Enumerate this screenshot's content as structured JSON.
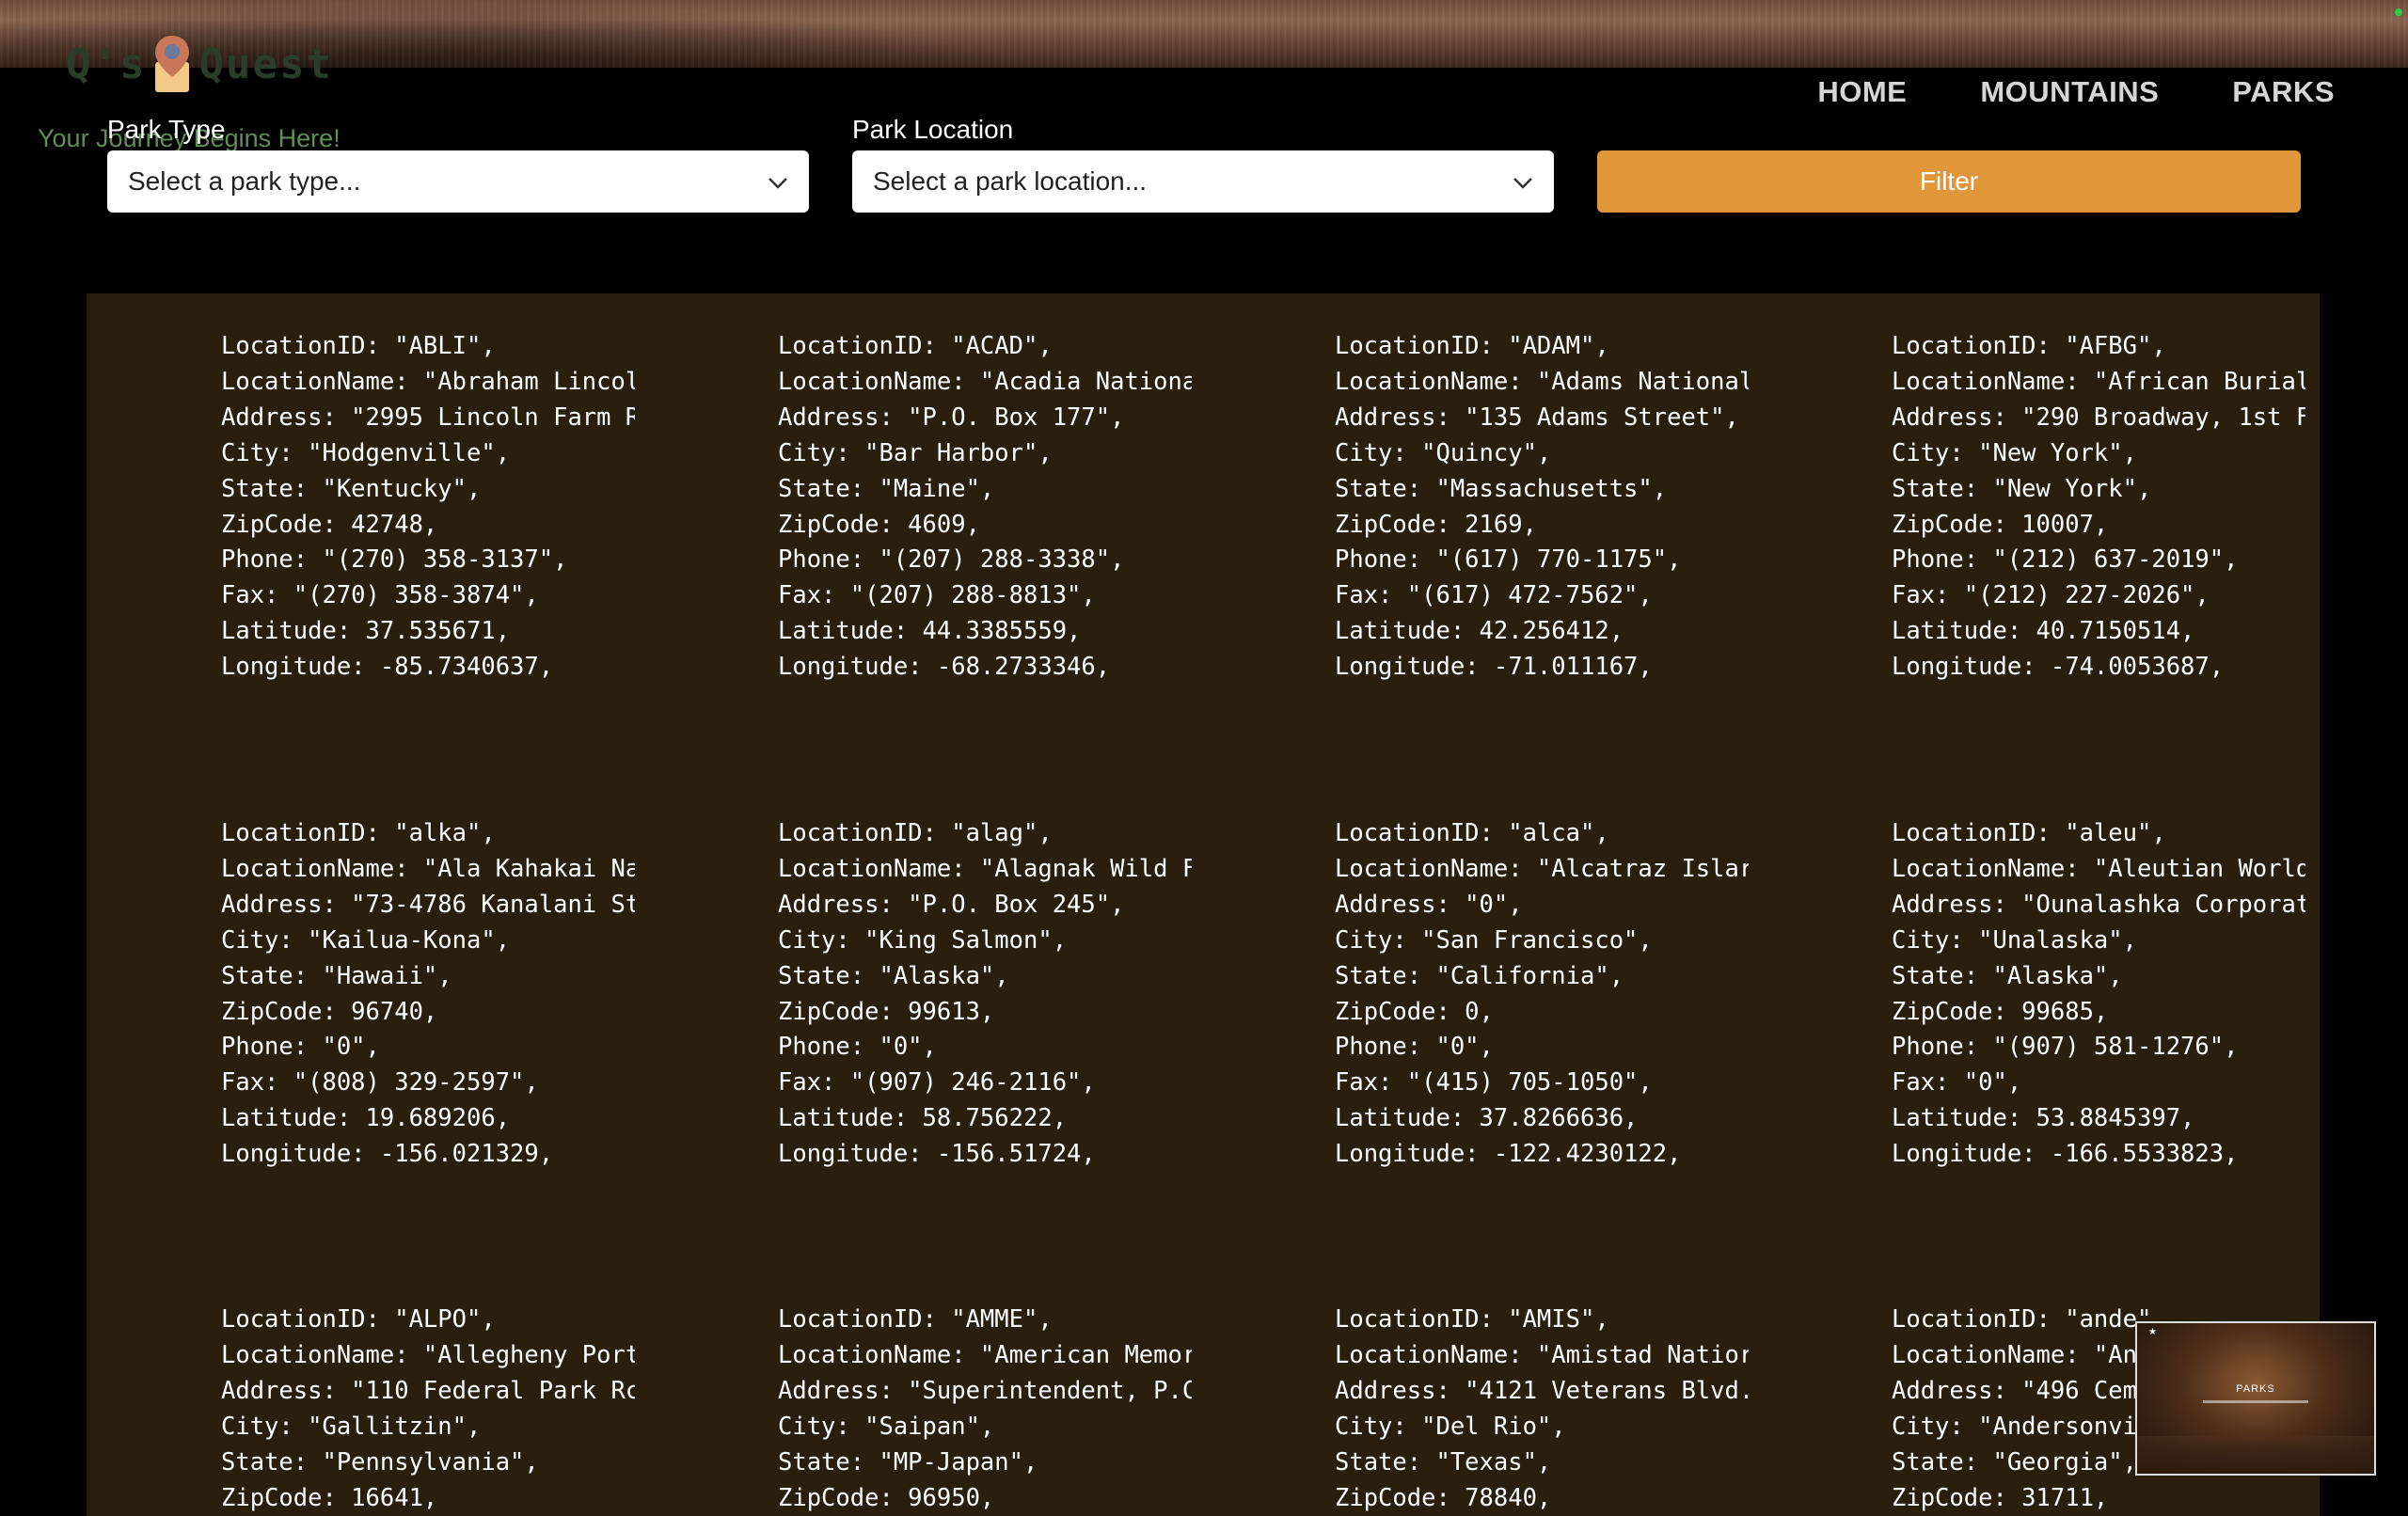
{
  "brand": {
    "logo_left": "Q's",
    "logo_right": "Quest",
    "tagline": "Your Journey Begins Here!"
  },
  "nav": {
    "home": "HOME",
    "mountains": "MOUNTAINS",
    "parks": "PARKS"
  },
  "filters": {
    "type_label": "Park Type",
    "type_placeholder": "Select a park type...",
    "location_label": "Park Location",
    "location_placeholder": "Select a park location...",
    "filter_button": "Filter"
  },
  "thumbnail": {
    "title": "PARKS"
  },
  "parks": [
    [
      "LocationID: \"ABLI\",",
      "LocationName: \"Abraham Lincoln",
      "Address: \"2995 Lincoln Farm R",
      "City: \"Hodgenville\",",
      "State: \"Kentucky\",",
      "ZipCode: 42748,",
      "Phone: \"(270) 358-3137\",",
      "Fax: \"(270) 358-3874\",",
      "Latitude: 37.535671,",
      "Longitude: -85.7340637,"
    ],
    [
      "LocationID: \"ACAD\",",
      "LocationName: \"Acadia Nationa",
      "Address: \"P.O. Box 177\",",
      "City: \"Bar Harbor\",",
      "State: \"Maine\",",
      "ZipCode: 4609,",
      "Phone: \"(207) 288-3338\",",
      "Fax: \"(207) 288-8813\",",
      "Latitude: 44.3385559,",
      "Longitude: -68.2733346,"
    ],
    [
      "LocationID: \"ADAM\",",
      "LocationName: \"Adams National",
      "Address: \"135 Adams Street\",",
      "City: \"Quincy\",",
      "State: \"Massachusetts\",",
      "ZipCode: 2169,",
      "Phone: \"(617) 770-1175\",",
      "Fax: \"(617) 472-7562\",",
      "Latitude: 42.256412,",
      "Longitude: -71.011167,"
    ],
    [
      "LocationID: \"AFBG\",",
      "LocationName: \"African Burial",
      "Address: \"290 Broadway, 1st F",
      "City: \"New York\",",
      "State: \"New York\",",
      "ZipCode: 10007,",
      "Phone: \"(212) 637-2019\",",
      "Fax: \"(212) 227-2026\",",
      "Latitude: 40.7150514,",
      "Longitude: -74.0053687,"
    ],
    [
      "LocationID: \"alka\",",
      "LocationName: \"Ala Kahakai Na",
      "Address: \"73-4786 Kanalani St",
      "City: \"Kailua-Kona\",",
      "State: \"Hawaii\",",
      "ZipCode: 96740,",
      "Phone: \"0\",",
      "Fax: \"(808) 329-2597\",",
      "Latitude: 19.689206,",
      "Longitude: -156.021329,"
    ],
    [
      "LocationID: \"alag\",",
      "LocationName: \"Alagnak Wild F",
      "Address: \"P.O. Box 245\",",
      "City: \"King Salmon\",",
      "State: \"Alaska\",",
      "ZipCode: 99613,",
      "Phone: \"0\",",
      "Fax: \"(907) 246-2116\",",
      "Latitude: 58.756222,",
      "Longitude: -156.51724,"
    ],
    [
      "LocationID: \"alca\",",
      "LocationName: \"Alcatraz Islar",
      "Address: \"0\",",
      "City: \"San Francisco\",",
      "State: \"California\",",
      "ZipCode: 0,",
      "Phone: \"0\",",
      "Fax: \"(415) 705-1050\",",
      "Latitude: 37.8266636,",
      "Longitude: -122.4230122,"
    ],
    [
      "LocationID: \"aleu\",",
      "LocationName: \"Aleutian World",
      "Address: \"Ounalashka Corporat",
      "City: \"Unalaska\",",
      "State: \"Alaska\",",
      "ZipCode: 99685,",
      "Phone: \"(907) 581-1276\",",
      "Fax: \"0\",",
      "Latitude: 53.8845397,",
      "Longitude: -166.5533823,"
    ],
    [
      "LocationID: \"ALPO\",",
      "LocationName: \"Allegheny Port",
      "Address: \"110 Federal Park Rc",
      "City: \"Gallitzin\",",
      "State: \"Pennsylvania\",",
      "ZipCode: 16641,"
    ],
    [
      "LocationID: \"AMME\",",
      "LocationName: \"American Memor",
      "Address: \"Superintendent, P.C",
      "City: \"Saipan\",",
      "State: \"MP-Japan\",",
      "ZipCode: 96950,"
    ],
    [
      "LocationID: \"AMIS\",",
      "LocationName: \"Amistad Natior",
      "Address: \"4121 Veterans Blvd.",
      "City: \"Del Rio\",",
      "State: \"Texas\",",
      "ZipCode: 78840,"
    ],
    [
      "LocationID: \"ande\",",
      "LocationName: \"An",
      "Address: \"496 Cem",
      "City: \"Andersonvi",
      "State: \"Georgia\",",
      "ZipCode: 31711,"
    ]
  ]
}
